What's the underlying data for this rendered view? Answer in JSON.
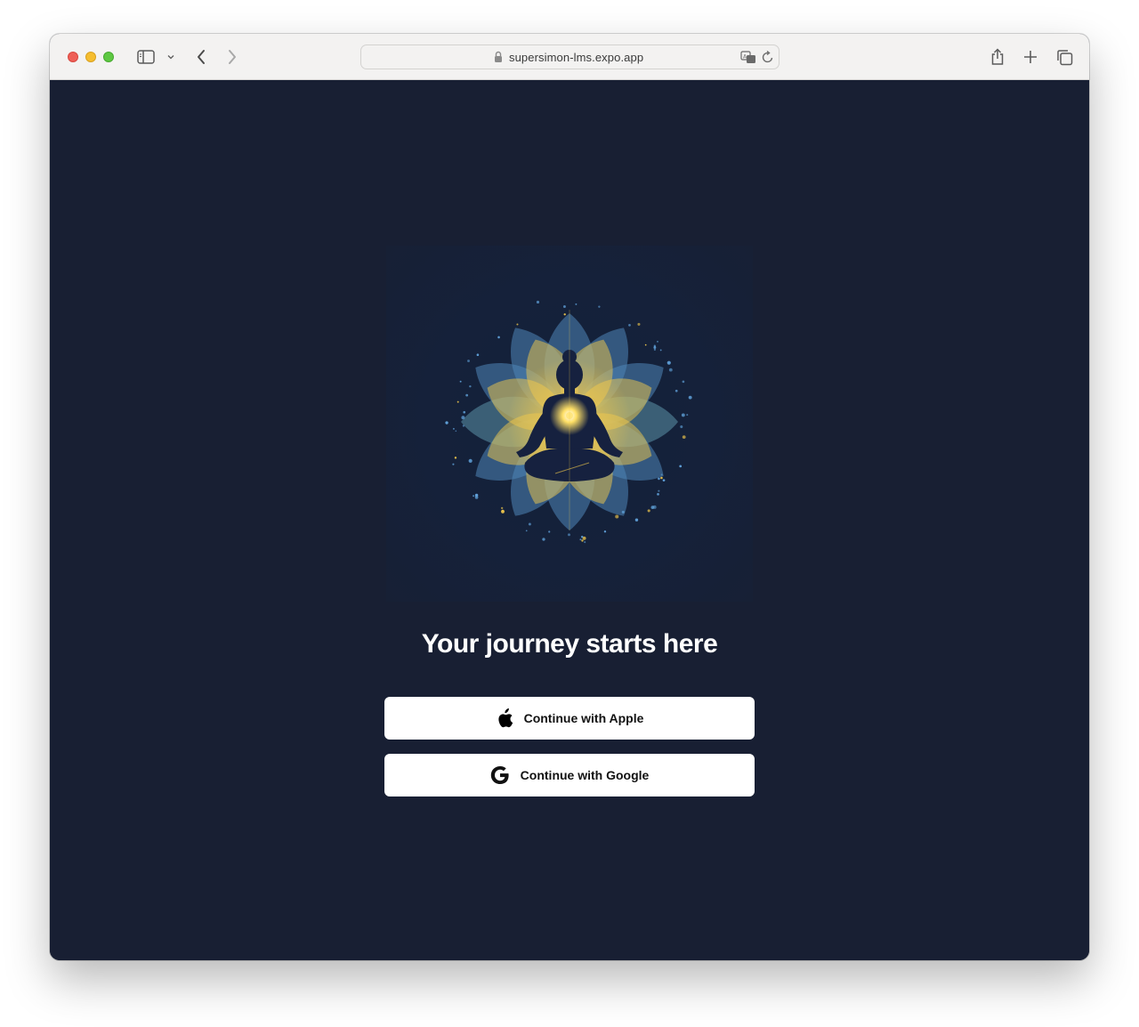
{
  "browser": {
    "url": "supersimon-lms.expo.app",
    "toolbar_icons": [
      "sidebar-icon",
      "chevron-down-icon",
      "back-icon",
      "forward-icon",
      "lock-icon",
      "translate-icon",
      "reload-icon",
      "share-icon",
      "new-tab-icon",
      "tabs-overview-icon"
    ]
  },
  "page": {
    "headline": "Your journey starts here",
    "hero_image": "meditation-lotus-illustration",
    "buttons": {
      "apple": {
        "label": "Continue with Apple",
        "icon": "apple-icon"
      },
      "google": {
        "label": "Continue with Google",
        "icon": "google-icon"
      }
    }
  },
  "colors": {
    "background": "#181f33",
    "button_bg": "#ffffff",
    "petal_yellow": "#f2c94c",
    "petal_blue": "#4f86b8"
  }
}
